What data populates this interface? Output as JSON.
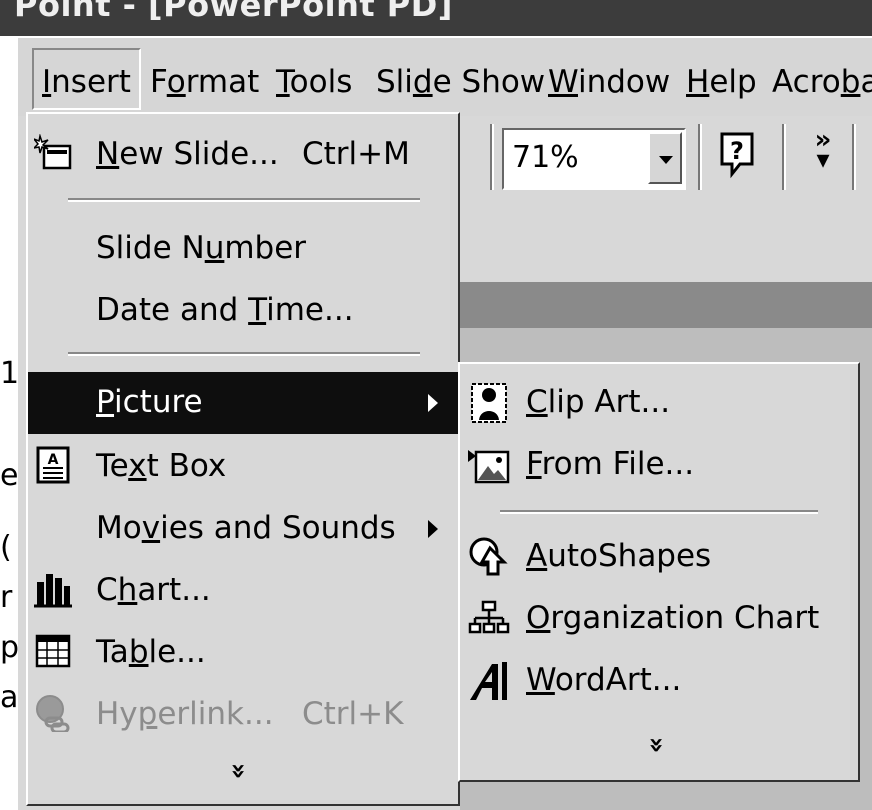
{
  "title_bar": {
    "text": "Point - [PowerPoint PD]"
  },
  "menu_bar": {
    "items": [
      {
        "label": "Insert",
        "underline": "I"
      },
      {
        "label": "Format",
        "underline": "o"
      },
      {
        "label": "Tools",
        "underline": "T"
      },
      {
        "label": "Slide Show",
        "underline": "d"
      },
      {
        "label": "Window",
        "underline": "W"
      },
      {
        "label": "Help",
        "underline": "H"
      },
      {
        "label": "Acroba",
        "underline": "b"
      }
    ]
  },
  "toolbar": {
    "zoom_value": "71%",
    "help_icon": "help-icon",
    "more_icon": "toolbar-options-chevron-icon"
  },
  "insert_menu": {
    "items": [
      {
        "label": "New Slide...",
        "shortcut": "Ctrl+M",
        "icon": "new-slide-icon"
      },
      {
        "label": "Slide Number"
      },
      {
        "label": "Date and Time..."
      },
      {
        "label": "Picture",
        "submenu": true,
        "highlighted": true
      },
      {
        "label": "Text Box",
        "icon": "text-box-icon"
      },
      {
        "label": "Movies and Sounds",
        "submenu": true
      },
      {
        "label": "Chart...",
        "icon": "chart-icon"
      },
      {
        "label": "Table...",
        "icon": "table-icon"
      },
      {
        "label": "Hyperlink...",
        "shortcut": "Ctrl+K",
        "icon": "hyperlink-icon",
        "disabled": true
      }
    ],
    "expand_glyph": "»"
  },
  "picture_submenu": {
    "items": [
      {
        "label": "Clip Art...",
        "icon": "clip-art-icon"
      },
      {
        "label": "From File...",
        "icon": "from-file-icon"
      },
      {
        "label": "AutoShapes",
        "icon": "autoshapes-icon"
      },
      {
        "label": "Organization Chart",
        "icon": "organization-chart-icon"
      },
      {
        "label": "WordArt...",
        "icon": "wordart-icon"
      }
    ],
    "expand_glyph": "»"
  },
  "left_edge_glyphs": [
    "1",
    "e",
    "(",
    "r",
    "p",
    "a"
  ]
}
